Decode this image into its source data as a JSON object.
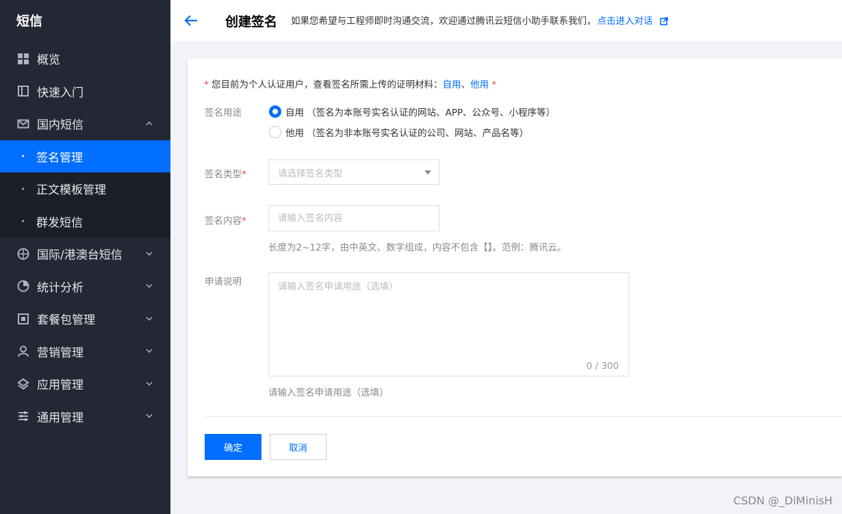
{
  "sidebar": {
    "title": "短信",
    "items": [
      {
        "label": "概览",
        "icon": "grid-icon"
      },
      {
        "label": "快速入门",
        "icon": "book-icon"
      },
      {
        "label": "国内短信",
        "icon": "mail-icon"
      }
    ],
    "sub_items": [
      {
        "label": "签名管理",
        "active": true
      },
      {
        "label": "正文模板管理",
        "active": false
      },
      {
        "label": "群发短信",
        "active": false
      }
    ],
    "bottom_items": [
      {
        "label": "国际/港澳台短信",
        "icon": "globe-icon"
      },
      {
        "label": "统计分析",
        "icon": "pie-chart-icon"
      },
      {
        "label": "套餐包管理",
        "icon": "package-icon"
      },
      {
        "label": "营销管理",
        "icon": "user-icon"
      },
      {
        "label": "应用管理",
        "icon": "layers-icon"
      },
      {
        "label": "通用管理",
        "icon": "sliders-icon"
      }
    ]
  },
  "header": {
    "title": "创建签名",
    "tip": "如果您希望与工程师即时沟通交流，欢迎通过腾讯云短信小助手联系我们，",
    "link": "点击进入对话"
  },
  "form": {
    "notice": {
      "star": "*",
      "text": " 您目前为个人认证用户，查看签名所需上传的证明材料：",
      "link_self": "自用",
      "sep": "、",
      "link_other": "他用",
      "star_end": " *"
    },
    "purpose": {
      "label": "签名用途",
      "options": [
        {
          "label": "自用",
          "desc": "（签名为本账号实名认证的网站、APP、公众号、小程序等）",
          "checked": true
        },
        {
          "label": "他用",
          "desc": "（签名为非本账号实名认证的公司、网站、产品名等）",
          "checked": false
        }
      ]
    },
    "type": {
      "label": "签名类型",
      "required": "*",
      "placeholder": "请选择签名类型"
    },
    "content": {
      "label": "签名内容",
      "required": "*",
      "placeholder": "请输入签名内容",
      "hint": "长度为2~12字，由中英文、数字组成，内容不包含【】。范例：腾讯云。"
    },
    "description": {
      "label": "申请说明",
      "placeholder": "请输入签名申请用途（选填）",
      "counter": "0 / 300",
      "hint": "请输入签名申请用途（选填）"
    },
    "buttons": {
      "confirm": "确定",
      "cancel": "取消"
    }
  },
  "watermark": "CSDN @_DiMinisH",
  "colors": {
    "accent": "#006eff",
    "sidebar_bg": "#232834",
    "required": "#e54545"
  }
}
